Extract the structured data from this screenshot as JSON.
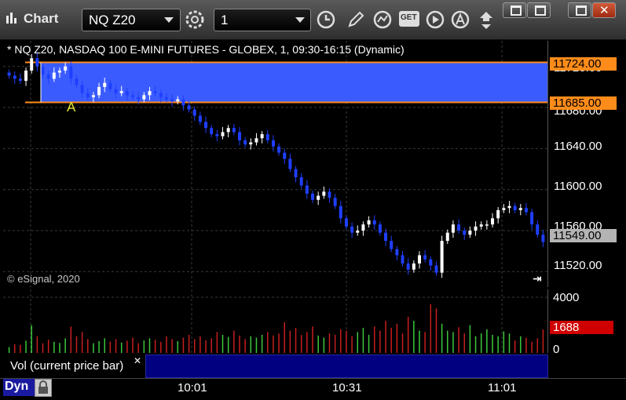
{
  "app": {
    "title": "Chart"
  },
  "toolbar": {
    "symbol": "NQ Z20",
    "interval": "1",
    "tools": [
      "settings-icon",
      "clock-icon",
      "pencil-icon",
      "study-icon",
      "get-icon",
      "play-icon",
      "alert-icon",
      "arrows-icon"
    ],
    "get_label": "GET"
  },
  "window": {
    "buttons": [
      "restore",
      "maximize-window",
      "minimize",
      "close"
    ]
  },
  "chart": {
    "header": "* NQ Z20, NASDAQ 100 E-MINI FUTURES - GLOBEX, 1, 09:30-16:15 (Dynamic)",
    "copyright": "© eSignal, 2020",
    "annotation": "A",
    "price_axis_labels": [
      "11720.00",
      "11680.00",
      "11640.00",
      "11600.00",
      "11560.00",
      "11520.00"
    ],
    "band_high": "11724.00",
    "band_low": "11685.00",
    "last_price": "11549.00",
    "colors": {
      "band": "#3a5cff",
      "band_line": "#ff8c1a",
      "up": "#ffffff",
      "down": "#1f3fff",
      "last_tag": "#b4b4b4"
    }
  },
  "volume": {
    "label": "Vol (current price bar)",
    "axis_labels": [
      "4000",
      "0"
    ],
    "current": "1688",
    "colors": {
      "up": "#3cc83c",
      "down": "#c81e1e",
      "tag": "#d00000"
    }
  },
  "time_axis": {
    "labels": [
      "10:01",
      "10:31",
      "11:01"
    ],
    "mode": "Dyn"
  },
  "chart_data": {
    "type": "candlestick",
    "price_ylim": [
      11505,
      11745
    ],
    "prices": [
      11711,
      11708,
      11706,
      11716,
      11728,
      11720,
      11712,
      11708,
      11714,
      11716,
      11720,
      11708,
      11702,
      11694,
      11690,
      11692,
      11700,
      11704,
      11698,
      11694,
      11696,
      11692,
      11690,
      11688,
      11692,
      11696,
      11694,
      11690,
      11688,
      11686,
      11688,
      11682,
      11678,
      11672,
      11666,
      11660,
      11654,
      11652,
      11656,
      11660,
      11656,
      11648,
      11644,
      11646,
      11650,
      11654,
      11648,
      11642,
      11636,
      11630,
      11620,
      11612,
      11604,
      11596,
      11590,
      11594,
      11598,
      11592,
      11584,
      11572,
      11564,
      11558,
      11560,
      11566,
      11570,
      11566,
      11558,
      11550,
      11542,
      11536,
      11528,
      11522,
      11528,
      11536,
      11532,
      11526,
      11519,
      11550,
      11558,
      11566,
      11560,
      11556,
      11560,
      11564,
      11566,
      11566,
      11572,
      11580,
      11582,
      11584,
      11580,
      11582,
      11578,
      11566,
      11556,
      11549
    ],
    "volumes": [
      420,
      620,
      580,
      880,
      2000,
      1200,
      700,
      950,
      800,
      720,
      1050,
      1900,
      1200,
      1500,
      1000,
      700,
      850,
      1050,
      820,
      1000,
      750,
      880,
      1100,
      700,
      900,
      1050,
      950,
      800,
      1200,
      1000,
      850,
      1100,
      1300,
      1000,
      1200,
      900,
      1050,
      1500,
      1300,
      1150,
      1600,
      1250,
      1000,
      1200,
      1100,
      1300,
      1500,
      1250,
      1400,
      2200,
      1600,
      1800,
      1300,
      1500,
      1900,
      1250,
      1100,
      1400,
      1300,
      1700,
      1600,
      1200,
      1500,
      1800,
      1300,
      1900,
      1600,
      2300,
      1800,
      2100,
      1400,
      2600,
      2300,
      1600,
      1500,
      3500,
      3200,
      2100,
      1600,
      1500,
      1850,
      1400,
      2000,
      1200,
      1400,
      1700,
      1300,
      1200,
      1550,
      1400,
      900,
      1200,
      1100,
      800,
      1050,
      1688
    ],
    "volume_ylim": [
      0,
      4000
    ],
    "band": [
      11685,
      11724
    ],
    "last": 11549
  }
}
